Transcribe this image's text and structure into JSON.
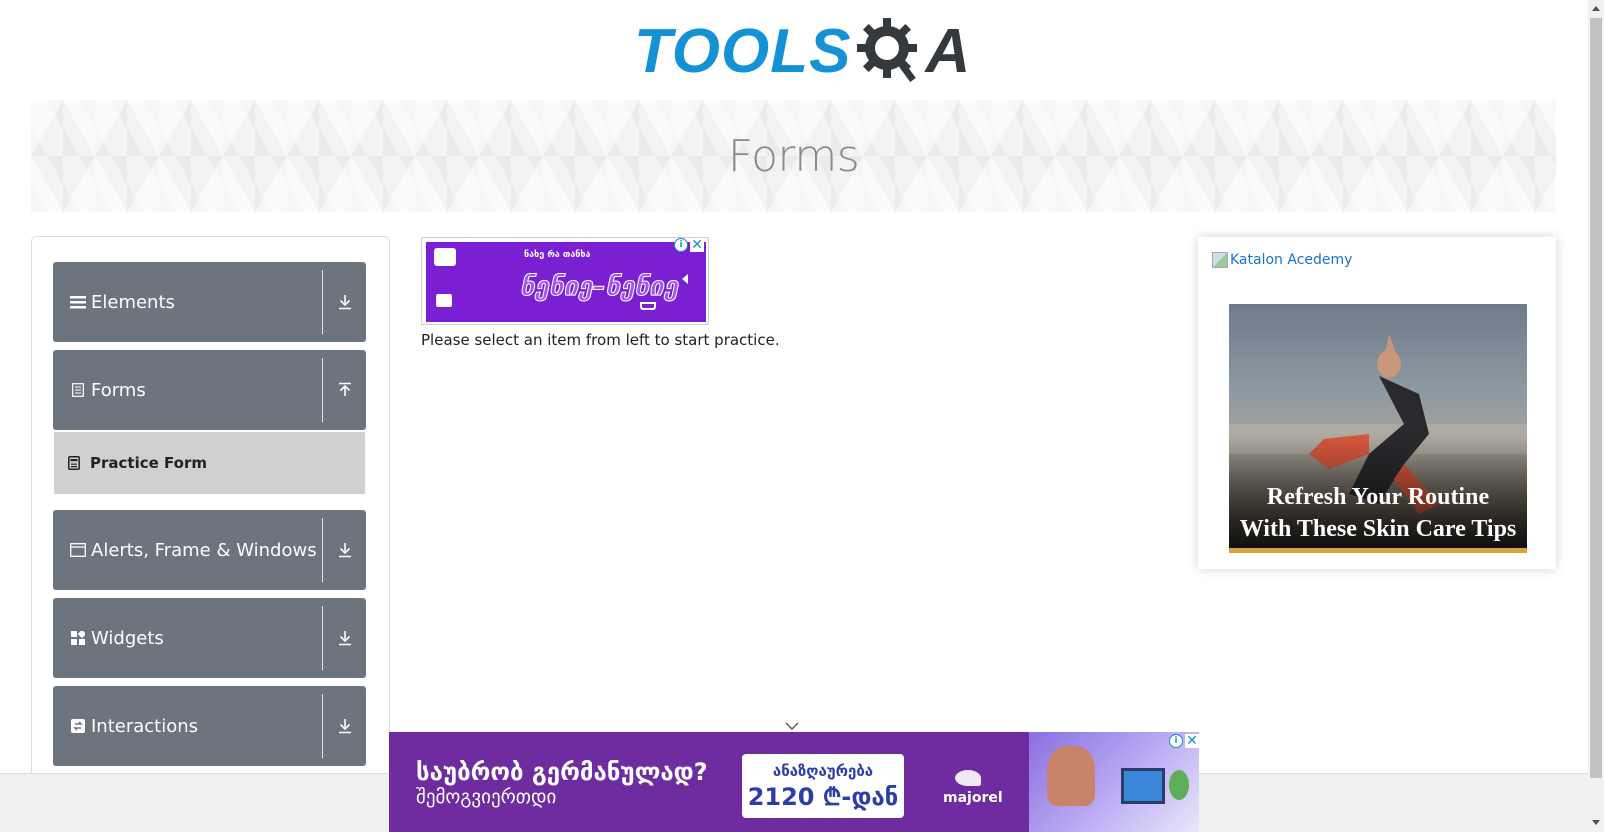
{
  "header": {
    "logo_word": "TOOLS",
    "logo_letter": "A"
  },
  "banner": {
    "title": "Forms"
  },
  "sidebar": {
    "groups": [
      {
        "label": "Elements",
        "icon": "menu-lines-icon",
        "expanded": false
      },
      {
        "label": "Forms",
        "icon": "document-icon",
        "expanded": true
      },
      {
        "label": "Alerts, Frame & Windows",
        "icon": "window-icon",
        "expanded": false
      },
      {
        "label": "Widgets",
        "icon": "widgets-icon",
        "expanded": false
      },
      {
        "label": "Interactions",
        "icon": "interactions-icon",
        "expanded": false
      }
    ],
    "sub_items": [
      {
        "label": "Practice Form",
        "icon": "form-icon"
      }
    ]
  },
  "main": {
    "instruction": "Please select an item from left to start practice.",
    "top_ad": {
      "line1": "ნახე რა თანხა",
      "line2": "ნენიე–ნენიე"
    }
  },
  "right_ad": {
    "image_alt": "Katalon Acedemy",
    "caption": "Refresh Your Routine With These Skin Care Tips"
  },
  "bottom_ad": {
    "line1": "საუბრობ გერმანულად?",
    "line2": "შემოგვიერთდი",
    "box_line1": "ანაზღაურება",
    "box_line2": "2120 ₾-დან",
    "brand": "majorel"
  },
  "colors": {
    "logo_blue": "#1591d5",
    "logo_dark": "#34393e",
    "sidebar_group_bg": "#6c757d",
    "sub_item_bg": "#d0d0d0",
    "ad_purple": "#6f2ca0",
    "link_blue": "#1a73c8"
  }
}
